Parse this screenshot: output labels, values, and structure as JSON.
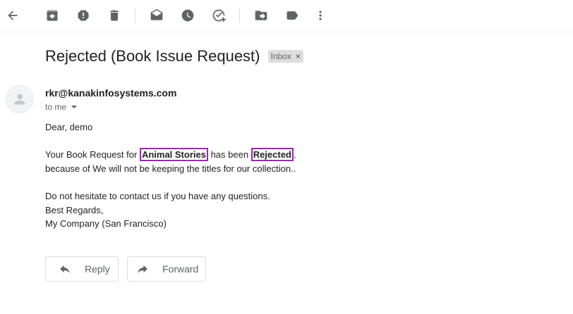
{
  "toolbar": {
    "back": "back",
    "archive": "archive",
    "report_spam": "report spam",
    "delete": "delete",
    "mark_unread": "mark as unread",
    "snooze": "snooze",
    "add_task": "add to tasks",
    "move_to": "move to",
    "labels": "labels",
    "more": "more"
  },
  "email": {
    "subject": "Rejected (Book Issue Request)",
    "label": "Inbox",
    "label_remove": "×",
    "sender": "rkr@kanakinfosystems.com",
    "to": "to me",
    "greeting": "Dear, demo",
    "line1_pre": "Your Book Request for ",
    "book_title": "Animal Stories",
    "line1_mid": " has been ",
    "status": "Rejected",
    "line1_post": ".",
    "line2": "because of We will not be keeping the titles for our collection..",
    "line3": "Do not hesitate to contact us if you have any questions.",
    "line4": "Best Regards,",
    "line5": "My Company (San Francisco)"
  },
  "actions": {
    "reply": "Reply",
    "forward": "Forward"
  }
}
